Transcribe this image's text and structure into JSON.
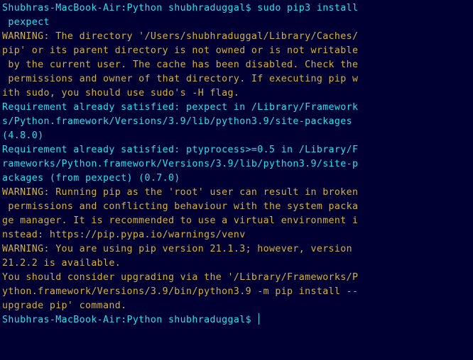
{
  "terminal": {
    "colors": {
      "background": "#000033",
      "prompt_and_output": "#27e0ec",
      "warning": "#d2b23c"
    },
    "lines": [
      {
        "text": "Shubhras-MacBook-Air:Python shubhraduggal$ sudo pip3 install",
        "style": "cyan"
      },
      {
        "text": " pexpect",
        "style": "cyan"
      },
      {
        "text": "WARNING: The directory '/Users/shubhraduggal/Library/Caches/",
        "style": "gold"
      },
      {
        "text": "pip' or its parent directory is not owned or is not writable",
        "style": "gold"
      },
      {
        "text": " by the current user. The cache has been disabled. Check the",
        "style": "gold"
      },
      {
        "text": " permissions and owner of that directory. If executing pip w",
        "style": "gold"
      },
      {
        "text": "ith sudo, you should use sudo's -H flag.",
        "style": "gold"
      },
      {
        "text": "Requirement already satisfied: pexpect in /Library/Framework",
        "style": "cyan"
      },
      {
        "text": "s/Python.framework/Versions/3.9/lib/python3.9/site-packages",
        "style": "cyan"
      },
      {
        "text": "(4.8.0)",
        "style": "cyan"
      },
      {
        "text": "Requirement already satisfied: ptyprocess>=0.5 in /Library/F",
        "style": "cyan"
      },
      {
        "text": "rameworks/Python.framework/Versions/3.9/lib/python3.9/site-p",
        "style": "cyan"
      },
      {
        "text": "ackages (from pexpect) (0.7.0)",
        "style": "cyan"
      },
      {
        "text": "WARNING: Running pip as the 'root' user can result in broken",
        "style": "gold"
      },
      {
        "text": " permissions and conflicting behaviour with the system packa",
        "style": "gold"
      },
      {
        "text": "ge manager. It is recommended to use a virtual environment i",
        "style": "gold"
      },
      {
        "text": "nstead: https://pip.pypa.io/warnings/venv",
        "style": "gold"
      },
      {
        "text": "WARNING: You are using pip version 21.1.3; however, version",
        "style": "gold"
      },
      {
        "text": "21.2.2 is available.",
        "style": "gold"
      },
      {
        "text": "You should consider upgrading via the '/Library/Frameworks/P",
        "style": "gold"
      },
      {
        "text": "ython.framework/Versions/3.9/bin/python3.9 -m pip install --",
        "style": "gold"
      },
      {
        "text": "upgrade pip' command.",
        "style": "gold"
      }
    ],
    "prompt": "Shubhras-MacBook-Air:Python shubhraduggal$ "
  }
}
